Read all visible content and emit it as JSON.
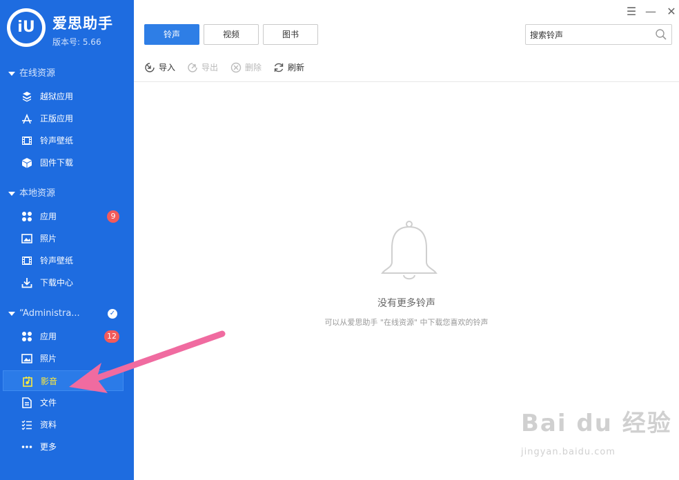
{
  "app": {
    "logo_text": "iU",
    "name": "爱思助手",
    "version": "版本号: 5.66"
  },
  "sidebar": {
    "groups": [
      {
        "title": "在线资源",
        "items": [
          {
            "label": "越狱应用",
            "icon": "box-stack-icon"
          },
          {
            "label": "正版应用",
            "icon": "app-store-icon"
          },
          {
            "label": "铃声壁纸",
            "icon": "film-strip-icon"
          },
          {
            "label": "固件下载",
            "icon": "cube-icon"
          }
        ]
      },
      {
        "title": "本地资源",
        "items": [
          {
            "label": "应用",
            "icon": "apps-grid-icon",
            "badge": "9"
          },
          {
            "label": "照片",
            "icon": "photo-icon"
          },
          {
            "label": "铃声壁纸",
            "icon": "film-strip-icon"
          },
          {
            "label": "下载中心",
            "icon": "download-icon"
          }
        ]
      },
      {
        "title": "“Administra...",
        "items": [
          {
            "label": "应用",
            "icon": "apps-grid-icon",
            "badge": "12"
          },
          {
            "label": "照片",
            "icon": "photo-icon"
          },
          {
            "label": "影音",
            "icon": "media-icon",
            "active": true
          },
          {
            "label": "文件",
            "icon": "file-icon"
          },
          {
            "label": "资料",
            "icon": "checklist-icon"
          },
          {
            "label": "更多",
            "icon": "more-dots-icon"
          }
        ]
      }
    ]
  },
  "tabs": [
    {
      "label": "铃声",
      "active": true
    },
    {
      "label": "视频",
      "active": false
    },
    {
      "label": "图书",
      "active": false
    }
  ],
  "search": {
    "placeholder": "搜索铃声"
  },
  "toolbar": {
    "import": "导入",
    "export": "导出",
    "delete": "删除",
    "refresh": "刷新"
  },
  "empty_state": {
    "title": "没有更多铃声",
    "subtitle": "可以从爱思助手 \"在线资源\" 中下载您喜欢的铃声"
  },
  "watermark": {
    "main": "Bai du 经验",
    "sub": "jingyan.baidu.com"
  },
  "colors": {
    "sidebar_bg": "#1e6ce0",
    "active_tab": "#2e7ee6",
    "badge": "#f25a5a",
    "active_label": "#ffeb3b",
    "annotation_arrow": "#f06ba0"
  }
}
